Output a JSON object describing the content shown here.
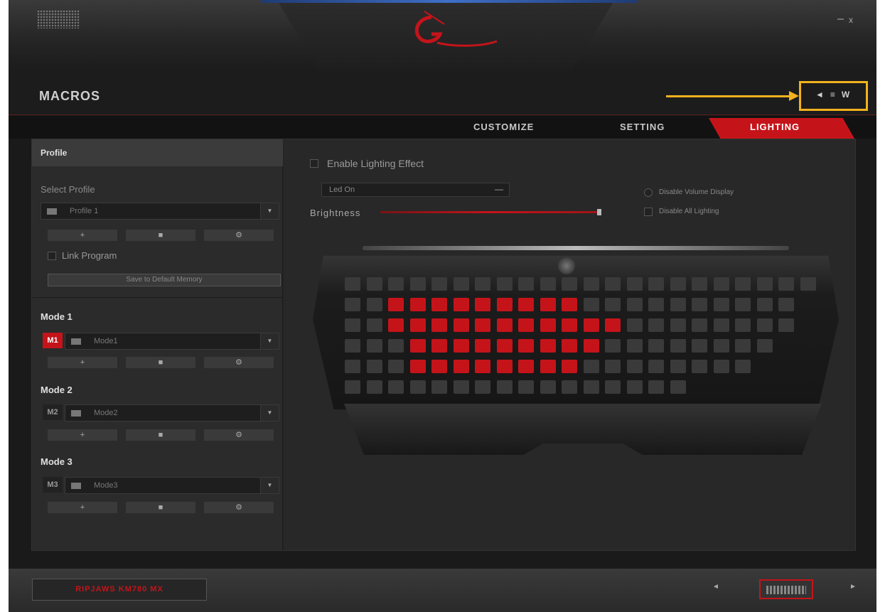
{
  "window": {
    "minimize_label": "–",
    "close_label": "x"
  },
  "header": {
    "title": "MACROS",
    "icons": [
      "◄",
      "≡",
      "W"
    ],
    "accent_color": "#c4141a",
    "annotation_color": "#f2b21e"
  },
  "tabs": [
    {
      "label": "CUSTOMIZE",
      "active": false
    },
    {
      "label": "SETTING",
      "active": false
    },
    {
      "label": "LIGHTING",
      "active": true
    }
  ],
  "profile": {
    "header": "Profile",
    "select_label": "Select Profile",
    "selected": "Profile 1",
    "buttons": [
      "+",
      "■",
      "⚙"
    ],
    "link_program_label": "Link Program",
    "save_button": "Save to Default Memory"
  },
  "modes": [
    {
      "title": "Mode 1",
      "badge": "M1",
      "value": "Mode1",
      "active": true,
      "buttons": [
        "+",
        "■",
        "⚙"
      ]
    },
    {
      "title": "Mode 2",
      "badge": "M2",
      "value": "Mode2",
      "active": false,
      "buttons": [
        "+",
        "■",
        "⚙"
      ]
    },
    {
      "title": "Mode 3",
      "badge": "M3",
      "value": "Mode3",
      "active": false,
      "buttons": [
        "+",
        "■",
        "⚙"
      ]
    }
  ],
  "lighting": {
    "enable_label": "Enable Lighting Effect",
    "effect_selected": "Led On",
    "effect_dropdown_icon": "—",
    "brightness_label": "Brightness",
    "disable_volume_label": "Disable Volume Display",
    "disable_all_label": "Disable All Lighting"
  },
  "footer": {
    "model": "RIPJAWS KM780 MX",
    "prev_icon": "◄",
    "next_icon": "►"
  }
}
